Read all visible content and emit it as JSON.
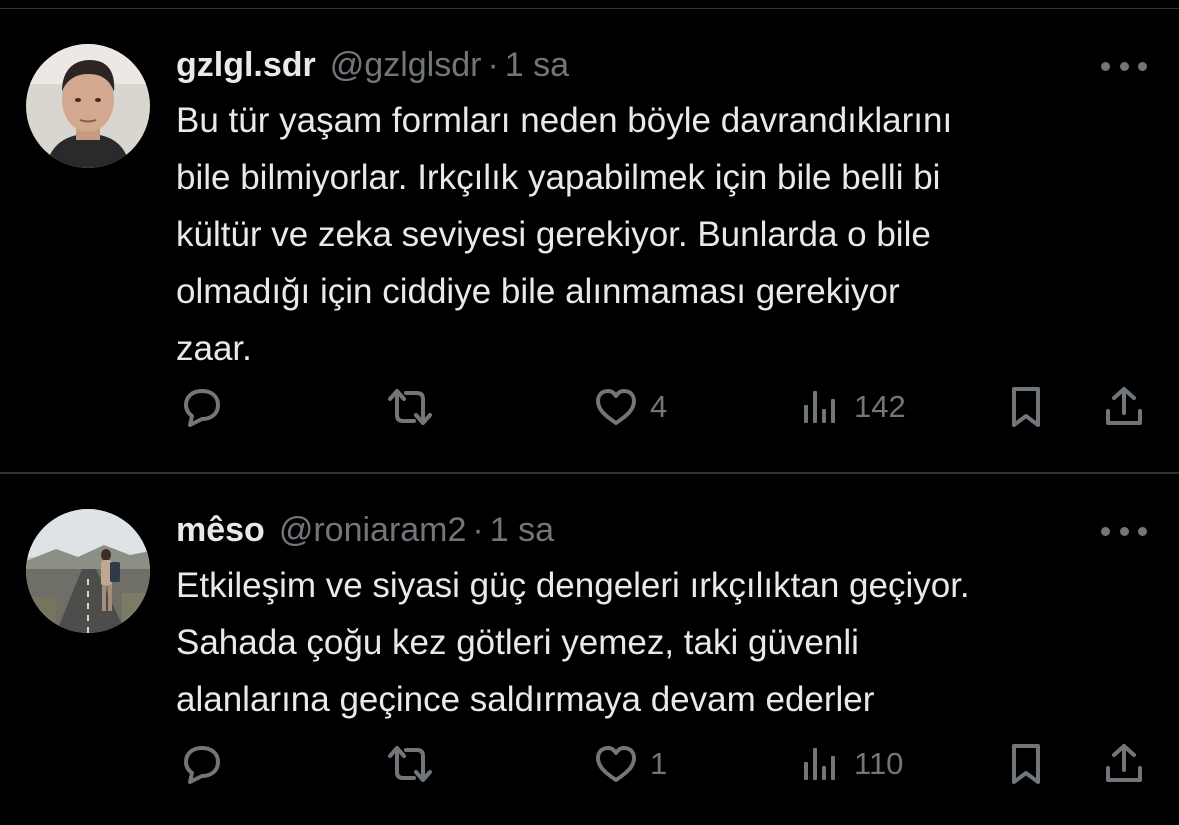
{
  "colors": {
    "background": "#000000",
    "primary_text": "#e7e9ea",
    "secondary_text": "#71767b",
    "divider": "#2f3336"
  },
  "tweets": [
    {
      "display_name": "gzlgl.sdr",
      "handle": "@gzlglsdr",
      "separator": "·",
      "time": "1 sa",
      "text": "Bu tür yaşam formları neden böyle davrandıklarını\nbile bilmiyorlar. Irkçılık yapabilmek için bile belli bi\nkültür ve zeka seviyesi gerekiyor. Bunlarda o bile\nolmadığı için ciddiye bile alınmaması gerekiyor\nzaar.",
      "actions": {
        "reply_icon": "speech-bubble-icon",
        "retweet_icon": "repost-arrows-icon",
        "like_icon": "heart-icon",
        "like_count": "4",
        "views_icon": "bar-chart-icon",
        "views_count": "142",
        "bookmark_icon": "bookmark-icon",
        "share_icon": "share-upload-icon"
      }
    },
    {
      "display_name": "mêso",
      "handle": "@roniaram2",
      "separator": "·",
      "time": "1 sa",
      "text": "Etkileşim ve siyasi güç dengeleri ırkçılıktan geçiyor.\nSahada çoğu kez götleri yemez, taki güvenli\nalanlarına geçince saldırmaya devam ederler",
      "actions": {
        "reply_icon": "speech-bubble-icon",
        "retweet_icon": "repost-arrows-icon",
        "like_icon": "heart-icon",
        "like_count": "1",
        "views_icon": "bar-chart-icon",
        "views_count": "110",
        "bookmark_icon": "bookmark-icon",
        "share_icon": "share-upload-icon"
      }
    }
  ]
}
